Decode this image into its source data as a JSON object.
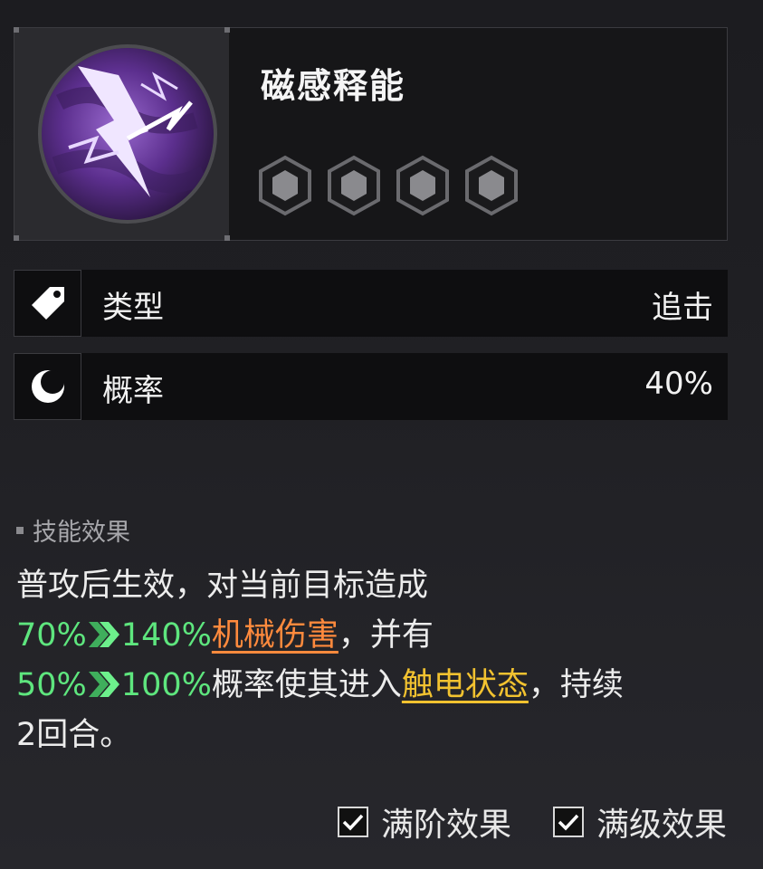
{
  "skill": {
    "name": "磁感释能",
    "rank_count": 4,
    "icon": "lightning-arrow-icon"
  },
  "stats": [
    {
      "icon": "tag-icon",
      "label": "类型",
      "value": "追击"
    },
    {
      "icon": "moon-icon",
      "label": "概率",
      "value": "40%"
    }
  ],
  "effect": {
    "section_title": "技能效果",
    "line1": "普攻后生效，对当前目标造成",
    "damage_from": "70%",
    "damage_to": "140%",
    "damage_type": "机械伤害",
    "line2_tail": "，并有",
    "chance_from": "50%",
    "chance_to": "100%",
    "chance_text": "概率使其进入",
    "status": "触电状态",
    "line3_tail": "，持续",
    "line4": "2回合。"
  },
  "toggles": [
    {
      "label": "满阶效果",
      "checked": true
    },
    {
      "label": "满级效果",
      "checked": true
    }
  ],
  "colors": {
    "green": "#5ee67e",
    "orange": "#ff8a3d",
    "yellow": "#f2c230",
    "portrait_purple": "#6a3aa0"
  }
}
